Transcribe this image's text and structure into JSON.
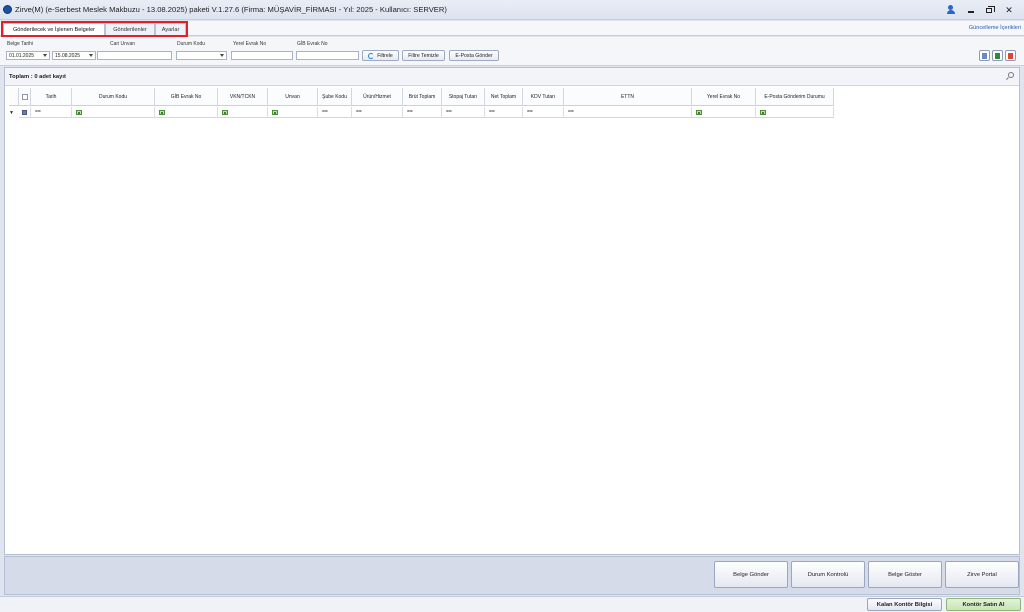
{
  "window": {
    "title": "Zirve(M)  (e-Serbest Meslek Makbuzu - 13.08.2025) paketi V.1.27.6 (Firma: MÜŞAVİR_FİRMASI - Yıl: 2025 - Kullanıcı: SERVER)"
  },
  "tabs": [
    {
      "label": "Gönderilecek ve İşlenen Belgeler",
      "active": true
    },
    {
      "label": "Gönderilenler",
      "active": false
    },
    {
      "label": "Ayarlar",
      "active": false
    }
  ],
  "update_link": "Güncelleme İçerikleri",
  "filters": {
    "belge_tarihi_label": "Belge Tarihi",
    "date_from": "01.01.2025",
    "date_to": "15.08.2025",
    "cari_unvan_label": "Cari Unvan",
    "durum_kodu_label": "Durum Kodu",
    "yerel_evrak_label": "Yerel Evrak No",
    "gib_evrak_label": "GİB Evrak No",
    "filtrele_button": "Filtrele",
    "filtre_temizle_button": "Filtre Temizle",
    "eposta_gonder_button": "E-Posta Gönder"
  },
  "grid": {
    "total_label": "Toplam : 0 adet kayıt",
    "columns": [
      "",
      "Tarih",
      "Durum Kodu",
      "GİB Evrak No",
      "VKN/TCKN",
      "Unvan",
      "Şube Kodu",
      "Ürün/Hizmet",
      "Brüt Toplam",
      "Stopaj Tutarı",
      "Net Toplam",
      "KDV Tutarı",
      "ETTN",
      "Yerel Evrak No",
      "E-Posta Gönderim Durumu"
    ],
    "filter_row": {
      "tarih": "==",
      "sube_kodu": "==",
      "urun": "==",
      "brut": "==",
      "stopaj": "==",
      "net": "==",
      "kdv": "==",
      "ettn": "=="
    }
  },
  "bottom_buttons": {
    "belge_gonder": "Belge Gönder",
    "durum_kontrolu": "Durum Kontrolü",
    "belge_goster": "Belge Göster",
    "zirve_portal": "Zirve Portal"
  },
  "status": {
    "kalan_kontor": "Kalan Kontör Bilgisi",
    "kontor_satin_al": "Kontör Satın Al"
  },
  "colors": {
    "accent_blue": "#2a58b0",
    "highlight_red": "#e3202a",
    "green_button": "#c7e6b4"
  }
}
